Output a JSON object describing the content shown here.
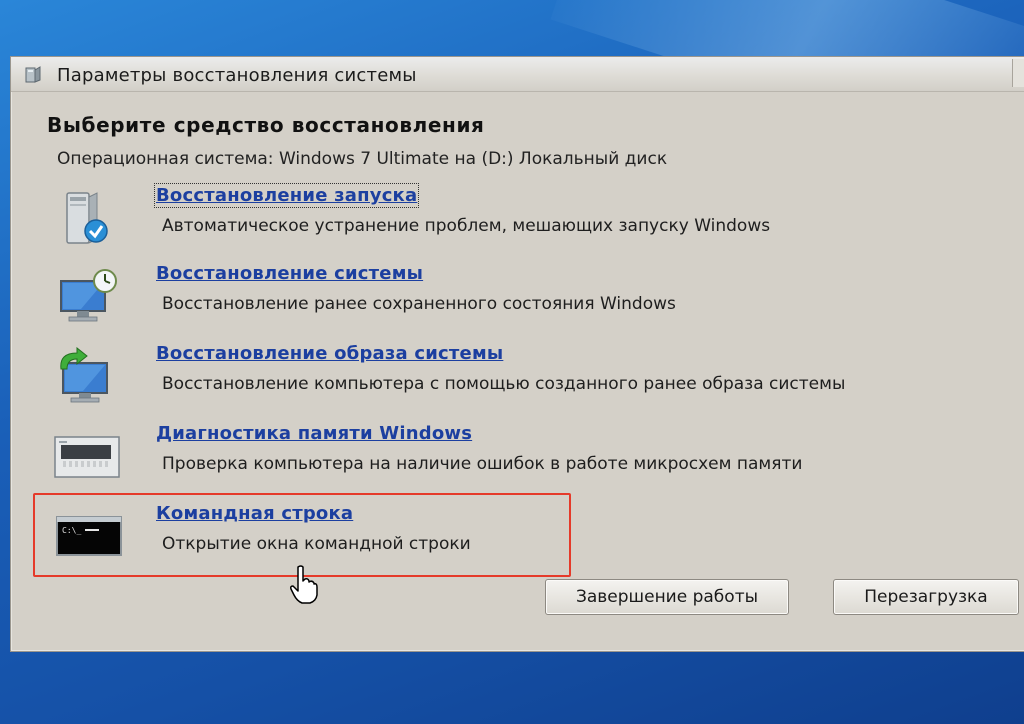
{
  "window": {
    "title": "Параметры восстановления системы"
  },
  "heading": "Выберите средство восстановления",
  "os_line": "Операционная система: Windows 7 Ultimate на (D:) Локальный диск",
  "tools": [
    {
      "icon": "startup-repair-icon",
      "label": "Восстановление запуска",
      "description": "Автоматическое устранение проблем, мешающих запуску Windows"
    },
    {
      "icon": "system-restore-icon",
      "label": "Восстановление системы",
      "description": "Восстановление ранее сохраненного состояния Windows"
    },
    {
      "icon": "system-image-recovery-icon",
      "label": "Восстановление образа системы",
      "description": "Восстановление компьютера с помощью  созданного ранее образа системы"
    },
    {
      "icon": "memory-diagnostic-icon",
      "label": "Диагностика памяти Windows",
      "description": "Проверка компьютера на наличие ошибок в работе микросхем памяти"
    },
    {
      "icon": "command-prompt-icon",
      "label": "Командная строка",
      "description": "Открытие окна командной строки"
    }
  ],
  "buttons": {
    "shutdown": "Завершение работы",
    "restart": "Перезагрузка"
  },
  "colors": {
    "link": "#1c3fa0",
    "highlight": "#e53a2a",
    "dialog_bg": "#d4d0c8",
    "desktop": "#1a5fb8"
  }
}
